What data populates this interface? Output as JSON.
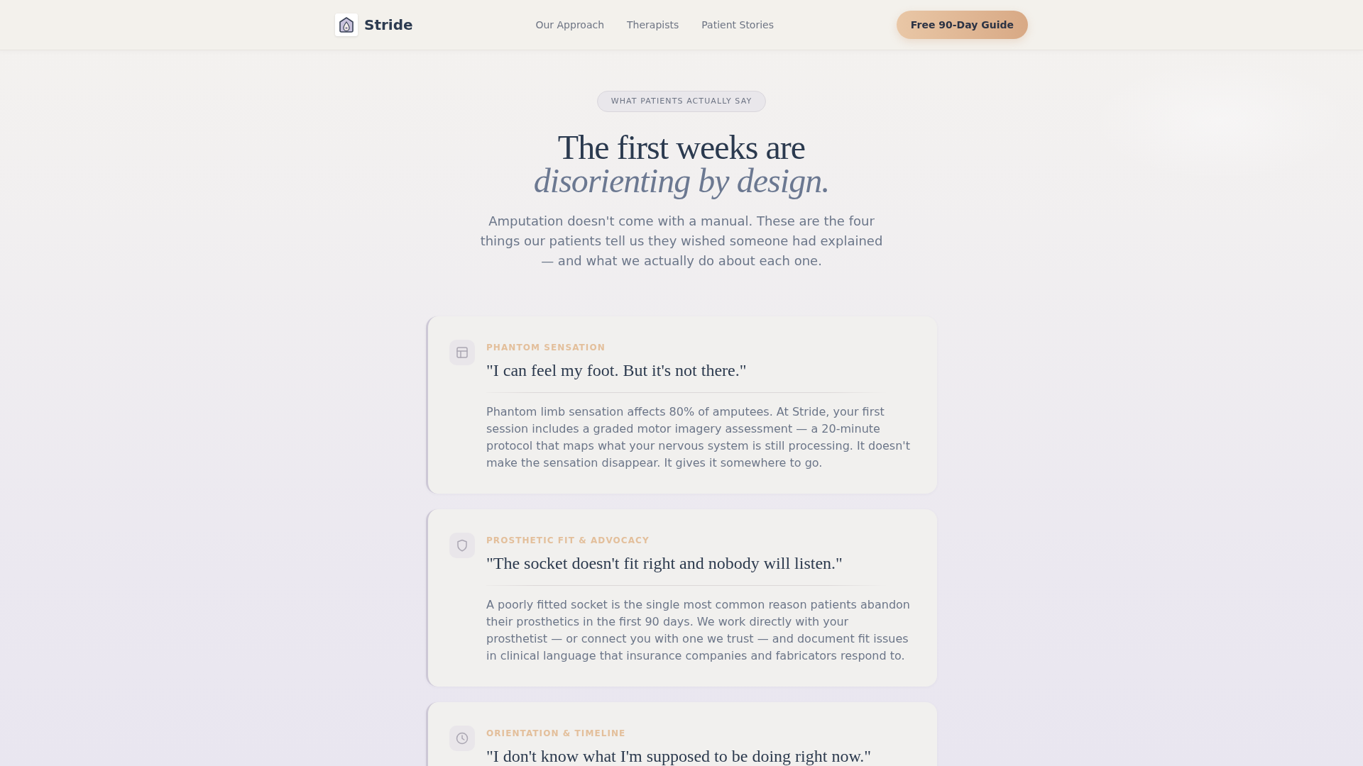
{
  "header": {
    "brand": "Stride",
    "nav": [
      "Our Approach",
      "Therapists",
      "Patient Stories"
    ],
    "cta": "Free 90-Day Guide"
  },
  "hero": {
    "badge": "WHAT PATIENTS ACTUALLY SAY",
    "title": "The first weeks are *disorienting by design.*",
    "intro": "Amputation doesn't come with a manual. These are the four things our patients tell us they wished someone had explained — and what we actually do about each one."
  },
  "cards": [
    {
      "category": "PHANTOM SENSATION",
      "quote": "\"I can feel my foot. But it's not there.\"",
      "body": "Phantom limb sensation affects 80% of amputees. At Stride, your first session includes a graded motor imagery assessment — a 20-minute protocol that maps what your nervous system is still processing. It doesn't make the sensation disappear. It gives it somewhere to go."
    },
    {
      "category": "PROSTHETIC FIT & ADVOCACY",
      "quote": "\"The socket doesn't fit right and nobody will listen.\"",
      "body": "A poorly fitted socket is the single most common reason patients abandon their prosthetics in the first 90 days. We work directly with your prosthetist — or connect you with one we trust — and document fit issues in clinical language that insurance companies and fabricators respond to."
    },
    {
      "category": "ORIENTATION & TIMELINE",
      "quote": "\"I don't know what I'm supposed to be doing right now.\""
    }
  ]
}
